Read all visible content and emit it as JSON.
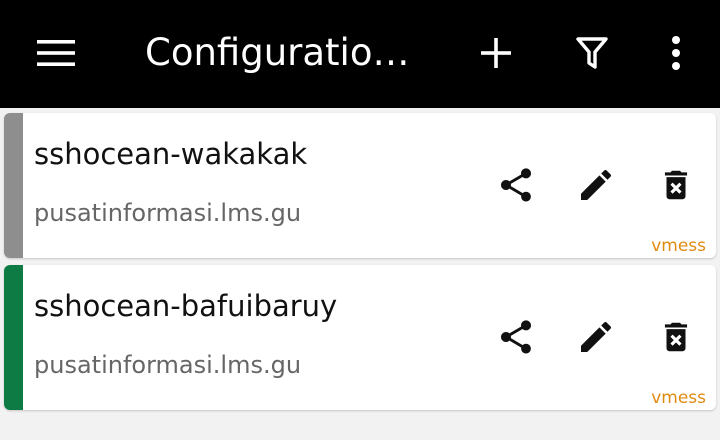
{
  "toolbar": {
    "title": "Configuratio…",
    "icons": [
      "menu-icon",
      "add-icon",
      "filter-icon",
      "more-vert-icon"
    ],
    "background": "#000000"
  },
  "configs": [
    {
      "name": "sshocean-wakakak",
      "address": "pusatinformasi.lms.gu",
      "type": "vmess",
      "status_color": "#8e8e8e"
    },
    {
      "name": "sshocean-bafuibaruy",
      "address": "pusatinformasi.lms.gu",
      "type": "vmess",
      "status_color": "#0e7a44"
    }
  ],
  "actions": [
    "share-icon",
    "edit-icon",
    "delete-icon"
  ],
  "colors": {
    "badge": "#e08a10",
    "icon": "#111111"
  }
}
